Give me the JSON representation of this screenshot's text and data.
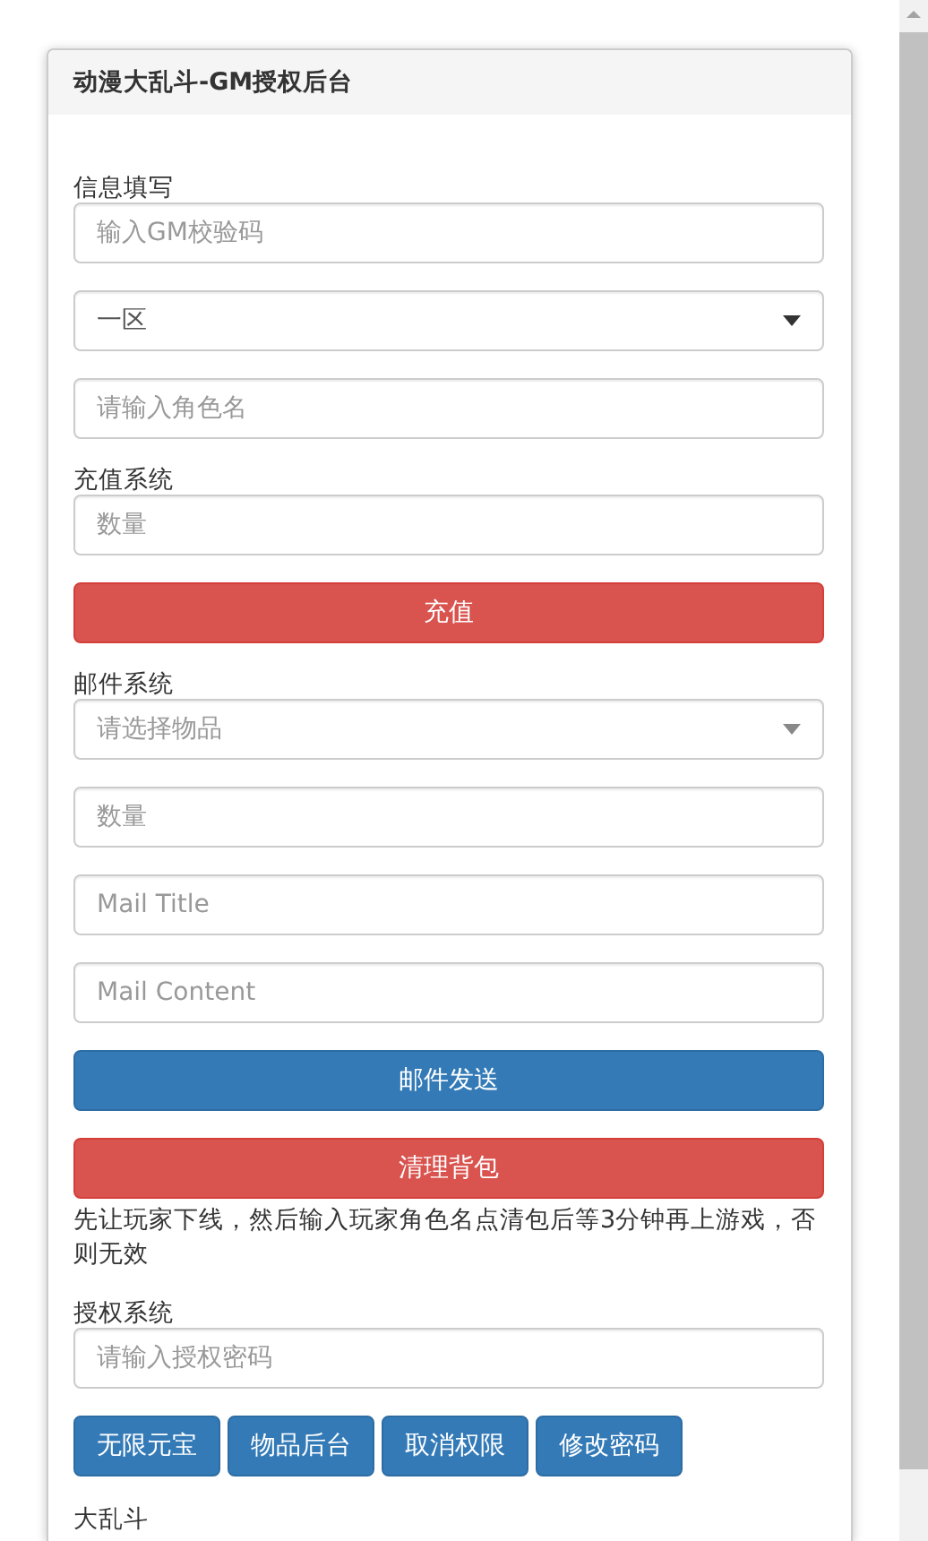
{
  "panel": {
    "title": "动漫大乱斗-GM授权后台"
  },
  "sections": [
    {
      "label": "信息填写",
      "items": [
        {
          "kind": "input",
          "placeholder": "输入GM校验码"
        },
        {
          "kind": "select",
          "value": "一区"
        },
        {
          "kind": "input",
          "placeholder": "请输入角色名"
        }
      ]
    },
    {
      "label": "充值系统",
      "items": [
        {
          "kind": "input",
          "placeholder": "数量"
        },
        {
          "kind": "danger_button",
          "label": "充值"
        }
      ]
    },
    {
      "label": "邮件系统",
      "items": [
        {
          "kind": "select",
          "placeholder": "请选择物品"
        },
        {
          "kind": "input",
          "placeholder": "数量"
        },
        {
          "kind": "input",
          "placeholder": "Mail Title"
        },
        {
          "kind": "input",
          "placeholder": "Mail Content"
        },
        {
          "kind": "primary_button",
          "label": "邮件发送"
        },
        {
          "kind": "danger_button",
          "label": "清理背包"
        },
        {
          "kind": "note",
          "text": "先让玩家下线，然后输入玩家角色名点清包后等3分钟再上游戏，否则无效"
        }
      ]
    },
    {
      "label": "授权系统",
      "items": [
        {
          "kind": "input",
          "placeholder": "请输入授权密码"
        },
        {
          "kind": "button_row",
          "buttons": [
            "无限元宝",
            "物品后台",
            "取消权限",
            "修改密码"
          ]
        }
      ]
    }
  ],
  "footer": "大乱斗"
}
